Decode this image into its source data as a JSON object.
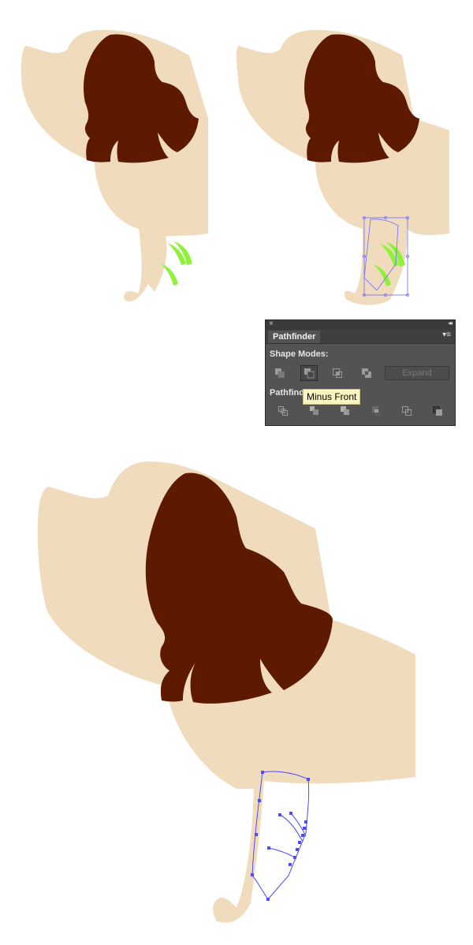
{
  "colors": {
    "fur": "#F0DCBD",
    "ear": "#5E1A00",
    "claw": "#8EF23A",
    "selection": "#4B4BFF",
    "panel_bg": "#535353"
  },
  "pathfinder_panel": {
    "close_glyph": "×",
    "collapse_glyph": "◂◂",
    "tab_label": "Pathfinder",
    "menu_glyph": "▾≡",
    "shape_modes_label": "Shape Modes:",
    "shape_mode_buttons": [
      {
        "name": "unite",
        "icon": "unite-icon"
      },
      {
        "name": "minus-front",
        "icon": "minus-front-icon",
        "active": true
      },
      {
        "name": "intersect",
        "icon": "intersect-icon"
      },
      {
        "name": "exclude",
        "icon": "exclude-icon"
      }
    ],
    "expand_label": "Expand",
    "pathfinders_label": "Pathfind",
    "pathfinder_buttons": [
      {
        "name": "divide",
        "icon": "divide-icon"
      },
      {
        "name": "trim",
        "icon": "trim-icon"
      },
      {
        "name": "merge",
        "icon": "merge-icon"
      },
      {
        "name": "crop",
        "icon": "crop-icon"
      },
      {
        "name": "outline",
        "icon": "outline-icon"
      },
      {
        "name": "minus-back",
        "icon": "minus-back-icon"
      }
    ],
    "tooltip": "Minus Front"
  }
}
